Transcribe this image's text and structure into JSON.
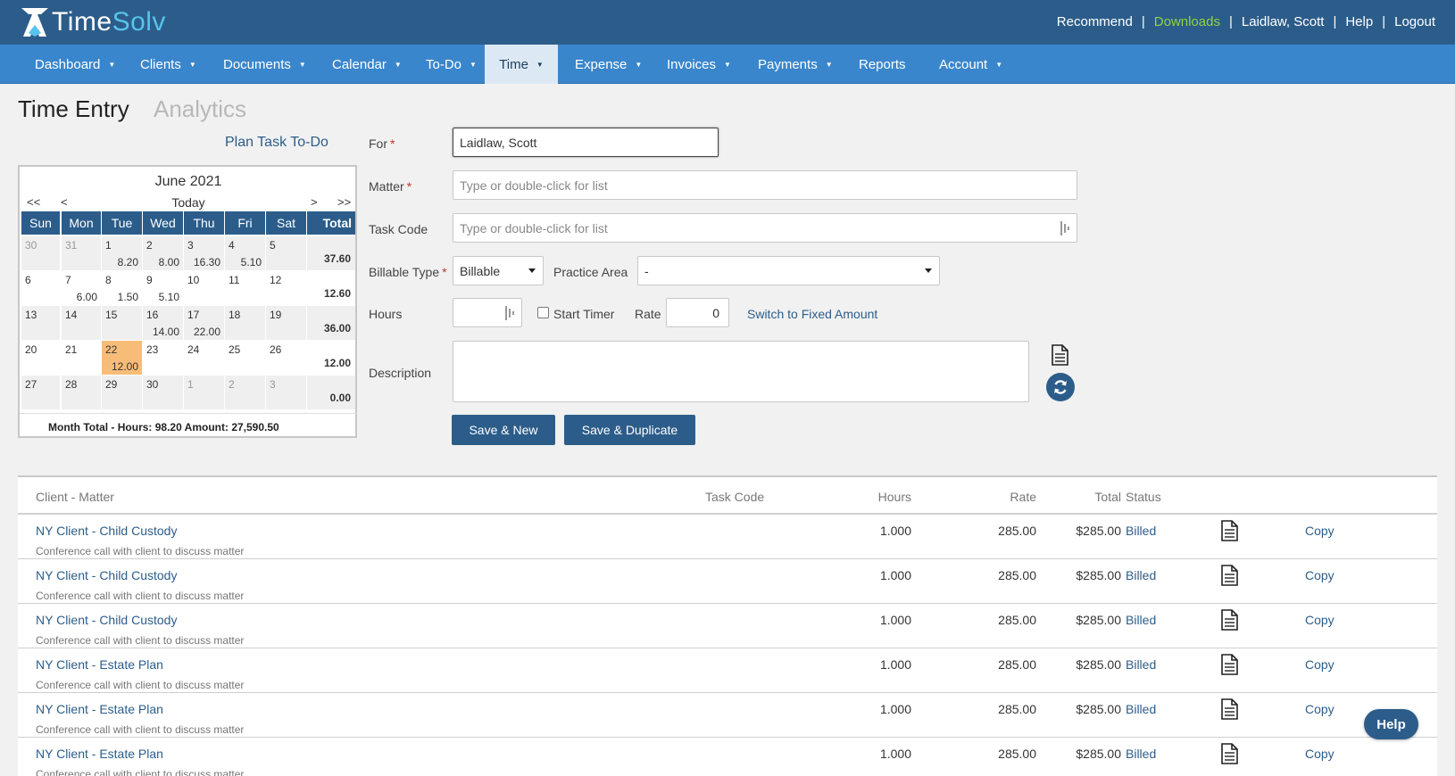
{
  "brand": {
    "logo_time": "Time",
    "logo_solv": "Solv"
  },
  "toplinks": {
    "recommend": "Recommend",
    "downloads": "Downloads",
    "user": "Laidlaw, Scott",
    "help": "Help",
    "logout": "Logout",
    "separator": "|"
  },
  "nav": [
    "Dashboard",
    "Clients",
    "Documents",
    "Calendar",
    "To-Do",
    "Time",
    "Expense",
    "Invoices",
    "Payments",
    "Reports",
    "Account"
  ],
  "nav_active": "Time",
  "page": {
    "title": "Time Entry",
    "analytics": "Analytics",
    "plan_link": "Plan Task To-Do"
  },
  "calendar": {
    "month": "June 2021",
    "today": "Today",
    "nav": {
      "prev_year": "<<",
      "prev": "<",
      "next": ">",
      "next_year": ">>"
    },
    "headers": [
      "Sun",
      "Mon",
      "Tue",
      "Wed",
      "Thu",
      "Fri",
      "Sat",
      "Total"
    ],
    "weeks": [
      {
        "days": [
          {
            "d": "30",
            "h": "",
            "other": true
          },
          {
            "d": "31",
            "h": "",
            "other": true
          },
          {
            "d": "1",
            "h": "8.20"
          },
          {
            "d": "2",
            "h": "8.00"
          },
          {
            "d": "3",
            "h": "16.30"
          },
          {
            "d": "4",
            "h": "5.10"
          },
          {
            "d": "5",
            "h": ""
          }
        ],
        "total": "37.60"
      },
      {
        "days": [
          {
            "d": "6",
            "h": ""
          },
          {
            "d": "7",
            "h": "6.00"
          },
          {
            "d": "8",
            "h": "1.50"
          },
          {
            "d": "9",
            "h": "5.10"
          },
          {
            "d": "10",
            "h": ""
          },
          {
            "d": "11",
            "h": ""
          },
          {
            "d": "12",
            "h": ""
          }
        ],
        "total": "12.60"
      },
      {
        "days": [
          {
            "d": "13",
            "h": ""
          },
          {
            "d": "14",
            "h": ""
          },
          {
            "d": "15",
            "h": ""
          },
          {
            "d": "16",
            "h": "14.00"
          },
          {
            "d": "17",
            "h": "22.00"
          },
          {
            "d": "18",
            "h": ""
          },
          {
            "d": "19",
            "h": ""
          }
        ],
        "total": "36.00"
      },
      {
        "days": [
          {
            "d": "20",
            "h": ""
          },
          {
            "d": "21",
            "h": ""
          },
          {
            "d": "22",
            "h": "12.00",
            "today": true
          },
          {
            "d": "23",
            "h": ""
          },
          {
            "d": "24",
            "h": ""
          },
          {
            "d": "25",
            "h": ""
          },
          {
            "d": "26",
            "h": ""
          }
        ],
        "total": "12.00"
      },
      {
        "days": [
          {
            "d": "27",
            "h": ""
          },
          {
            "d": "28",
            "h": ""
          },
          {
            "d": "29",
            "h": ""
          },
          {
            "d": "30",
            "h": ""
          },
          {
            "d": "1",
            "h": "",
            "other": true
          },
          {
            "d": "2",
            "h": "",
            "other": true
          },
          {
            "d": "3",
            "h": "",
            "other": true
          }
        ],
        "total": "0.00"
      }
    ],
    "month_total": "Month Total - Hours: 98.20   Amount: 27,590.50"
  },
  "form": {
    "for_label": "For",
    "for_value": "Laidlaw, Scott",
    "matter_label": "Matter",
    "matter_placeholder": "Type or double-click for list",
    "taskcode_label": "Task Code",
    "taskcode_placeholder": "Type or double-click for list",
    "billable_label": "Billable Type",
    "billable_value": "Billable",
    "practice_label": "Practice Area",
    "practice_value": "-",
    "hours_label": "Hours",
    "hours_value": "",
    "start_timer": "Start Timer",
    "rate_label": "Rate",
    "rate_value": "0",
    "switch_fixed": "Switch to Fixed Amount",
    "description_label": "Description",
    "description_value": "",
    "required_mark": "*",
    "save_new": "Save & New",
    "save_duplicate": "Save & Duplicate"
  },
  "table": {
    "headers": {
      "client_matter": "Client - Matter",
      "task_code": "Task Code",
      "hours": "Hours",
      "rate": "Rate",
      "total": "Total",
      "status": "Status"
    },
    "rows": [
      {
        "client_matter": "NY Client - Child Custody",
        "desc": "Conference call with client to discuss matter",
        "hours": "1.000",
        "rate": "285.00",
        "total": "$285.00",
        "status": "Billed",
        "copy": "Copy"
      },
      {
        "client_matter": "NY Client - Child Custody",
        "desc": "Conference call with client to discuss matter",
        "hours": "1.000",
        "rate": "285.00",
        "total": "$285.00",
        "status": "Billed",
        "copy": "Copy"
      },
      {
        "client_matter": "NY Client - Child Custody",
        "desc": "Conference call with client to discuss matter",
        "hours": "1.000",
        "rate": "285.00",
        "total": "$285.00",
        "status": "Billed",
        "copy": "Copy"
      },
      {
        "client_matter": "NY Client - Estate Plan",
        "desc": "Conference call with client to discuss matter",
        "hours": "1.000",
        "rate": "285.00",
        "total": "$285.00",
        "status": "Billed",
        "copy": "Copy"
      },
      {
        "client_matter": "NY Client - Estate Plan",
        "desc": "Conference call with client to discuss matter",
        "hours": "1.000",
        "rate": "285.00",
        "total": "$285.00",
        "status": "Billed",
        "copy": "Copy"
      },
      {
        "client_matter": "NY Client - Estate Plan",
        "desc": "Conference call with client to discuss matter",
        "hours": "1.000",
        "rate": "285.00",
        "total": "$285.00",
        "status": "Billed",
        "copy": "Copy"
      }
    ]
  },
  "help_button": "Help",
  "colors": {
    "header_bg": "#2c5d8a",
    "nav_bg": "#3a86cc",
    "accent_green": "#8fd33f",
    "today_highlight": "#f7bd78",
    "link": "#2c5d8a"
  },
  "icons": [
    "timesolv-logo-icon",
    "caret-down-icon",
    "document-icon",
    "refresh-icon",
    "grip-icon"
  ]
}
